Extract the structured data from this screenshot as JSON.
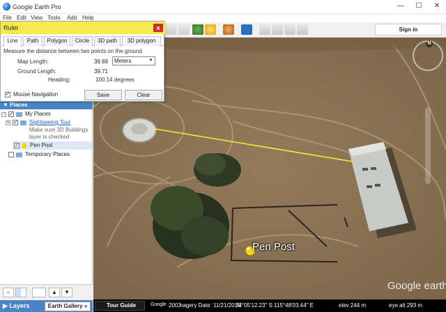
{
  "window": {
    "title": "Google Earth Pro",
    "minimize": "—",
    "maximize": "☐",
    "close": "✕"
  },
  "menu": [
    "File",
    "Edit",
    "View",
    "Tools",
    "Add",
    "Help"
  ],
  "toolbar": {
    "signin_label": "Sign in"
  },
  "ruler": {
    "title": "Ruler",
    "close_label": "x",
    "tabs": [
      "Line",
      "Path",
      "Polygon",
      "Circle",
      "3D path",
      "3D polygon"
    ],
    "active_tab": "Line",
    "instruction": "Measure the distance between two points on the ground",
    "map_length_label": "Map Length:",
    "map_length_value": "39.69",
    "unit": "Meters",
    "ground_length_label": "Ground Length:",
    "ground_length_value": "39.71",
    "heading_label": "Heading:",
    "heading_value": "100.14 degrees",
    "mouse_nav_label": "Mouse Navigation",
    "save_label": "Save",
    "clear_label": "Clear"
  },
  "places": {
    "header": "Places",
    "my_places": "My Places",
    "sightseeing": "Sightseeing Tour",
    "sightseeing_note1": "Make sure 3D Buildings",
    "sightseeing_note2": "layer is checked",
    "pen_post": "Pen Post",
    "temporary": "Temporary Places"
  },
  "layers": {
    "label": "Layers",
    "gallery_label": "Earth Gallery »"
  },
  "map": {
    "placemark_label": "Pen Post",
    "logo": "Google earth",
    "compass_n": "N"
  },
  "status": {
    "tour_guide": "Tour Guide",
    "imagery_year": "2003",
    "imagery_date": "nagery Date: 11/21/2015",
    "coords": "34°05'12.23\" S  115°48'03.44\" E",
    "elev": "elev  244 m",
    "eye_alt": "eye alt  293 m"
  }
}
